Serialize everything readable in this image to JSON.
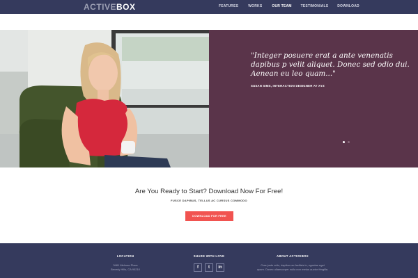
{
  "brand": {
    "part1": "ACTIVE",
    "part2": "BOX"
  },
  "nav": {
    "items": [
      "FEATURES",
      "WORKS",
      "OUR TEAM",
      "TESTIMONIALS",
      "DOWNLOAD"
    ],
    "active_index": 2
  },
  "testimonial": {
    "quote": "\"Integer posuere erat a ante venenatis dapibus p velit aliquet. Donec sed odio dui. Aenean eu leo quam...\"",
    "author": "SUSAN SIMS, INTERACTION DESIGNER AT XYZ",
    "slide_count": 2,
    "active_slide": 1
  },
  "cta": {
    "title": "Are You Ready to Start? Download Now For Free!",
    "subtitle": "FUSCE DAPIBUS, TELLUS AC CURSUS COMMODO",
    "button": "DOWNLOAD FOR FREE"
  },
  "footer": {
    "location": {
      "heading": "LOCATION",
      "line1": "3481 Melrose Place",
      "line2": "Beverly Hills, CA 90210"
    },
    "share": {
      "heading": "SHARE WITH LOVE",
      "icons": [
        "facebook-icon",
        "twitter-icon",
        "linkedin-icon"
      ],
      "glyphs": [
        "f",
        "t",
        "in"
      ]
    },
    "about": {
      "heading": "ABOUT ACTIVEBOX",
      "line1": "Cras justo odio, dapibus ac facilisis in, egestas eget",
      "line2": "quam. Donec ullamcorper nulla non metus auctor fringilla."
    }
  },
  "colors": {
    "nav_bg": "#353a5d",
    "slide_bg": "#5a344a",
    "cta_button": "#f15350"
  }
}
